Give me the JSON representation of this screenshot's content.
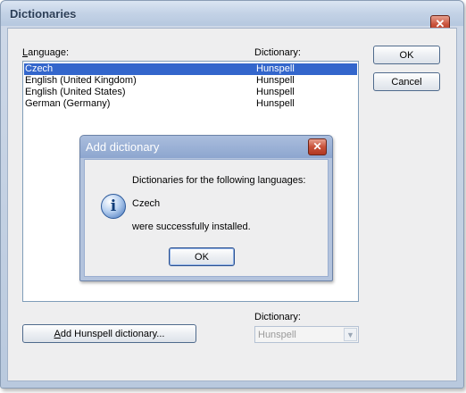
{
  "window": {
    "title": "Dictionaries",
    "close_glyph": "✕"
  },
  "labels": {
    "language_pre": "",
    "language_u": "L",
    "language_rest": "anguage:",
    "dictionary_header": "Dictionary:",
    "dictionary_bottom": "Dictionary:"
  },
  "list": {
    "rows": [
      {
        "language": "Czech",
        "dictionary": "Hunspell",
        "selected": true
      },
      {
        "language": "English (United Kingdom)",
        "dictionary": "Hunspell",
        "selected": false
      },
      {
        "language": "English (United States)",
        "dictionary": "Hunspell",
        "selected": false
      },
      {
        "language": "German (Germany)",
        "dictionary": "Hunspell",
        "selected": false
      }
    ]
  },
  "buttons": {
    "ok": "OK",
    "cancel": "Cancel",
    "add_u": "A",
    "add_rest": "dd Hunspell dictionary..."
  },
  "combo": {
    "value": "Hunspell"
  },
  "modal": {
    "title": "Add dictionary",
    "close_glyph": "✕",
    "line1": "Dictionaries for the following languages:",
    "line2": "Czech",
    "line3": "were successfully installed.",
    "ok": "OK",
    "icon": "info-icon",
    "icon_glyph": "i"
  },
  "colors": {
    "selection": "#3366cc",
    "close": "#c9523a"
  }
}
